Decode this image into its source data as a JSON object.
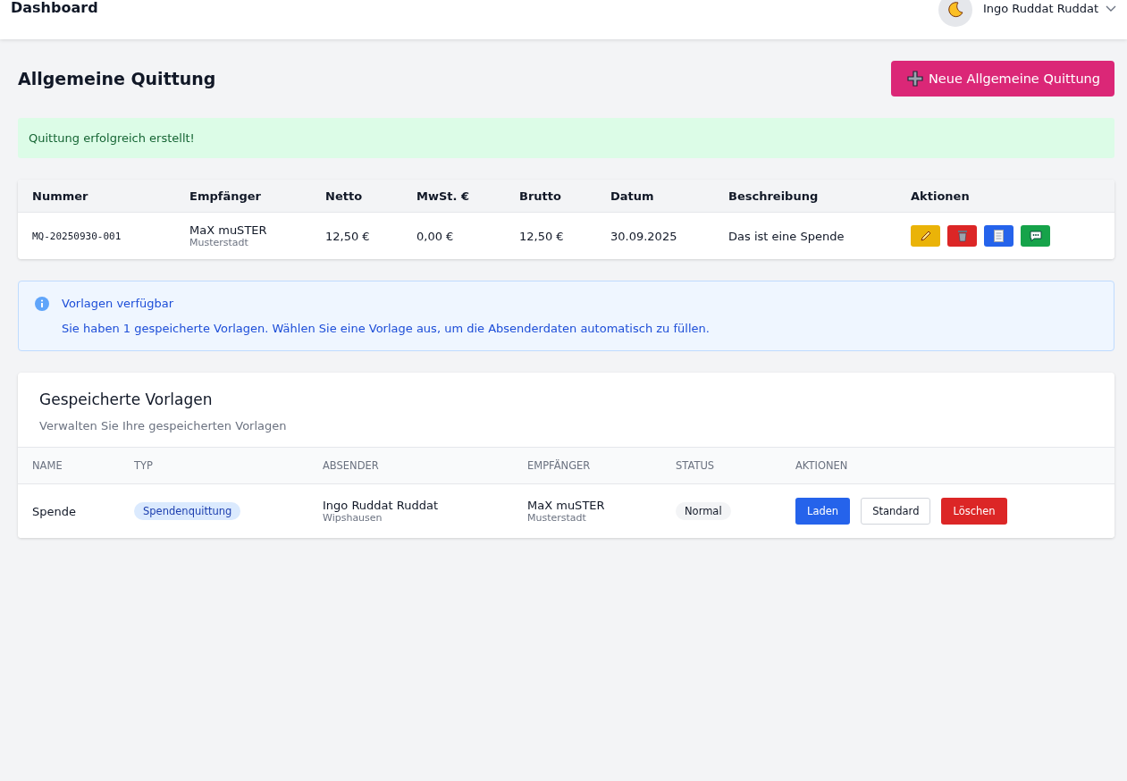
{
  "header": {
    "title": "Dashboard",
    "user": "Ingo Ruddat Ruddat"
  },
  "page": {
    "title": "Allgemeine Quittung",
    "new_button": "Neue Allgemeine Quittung"
  },
  "alert": "Quittung erfolgreich erstellt!",
  "receipts": {
    "columns": [
      "Nummer",
      "Empfänger",
      "Netto",
      "MwSt. €",
      "Brutto",
      "Datum",
      "Beschreibung",
      "Aktionen"
    ],
    "rows": [
      {
        "nummer": "MQ-20250930-001",
        "empfaenger": "MaX muSTER",
        "ort": "Musterstadt",
        "netto": "12,50 €",
        "mwst": "0,00 €",
        "brutto": "12,50 €",
        "datum": "30.09.2025",
        "beschreibung": "Das ist eine Spende",
        "actions": [
          {
            "kind": "edit"
          },
          {
            "kind": "delete"
          },
          {
            "kind": "document"
          },
          {
            "kind": "message"
          }
        ]
      }
    ]
  },
  "info": {
    "title": "Vorlagen verfügbar",
    "text": "Sie haben 1 gespeicherte Vorlagen. Wählen Sie eine Vorlage aus, um die Absenderdaten automatisch zu füllen."
  },
  "templates": {
    "title": "Gespeicherte Vorlagen",
    "subtitle": "Verwalten Sie Ihre gespeicherten Vorlagen",
    "columns": [
      "NAME",
      "TYP",
      "ABSENDER",
      "EMPFÄNGER",
      "STATUS",
      "AKTIONEN"
    ],
    "rows": [
      {
        "name": "Spende",
        "typ": "Spendenquittung",
        "absender": "Ingo Ruddat Ruddat",
        "absender_ort": "Wipshausen",
        "empfaenger": "MaX muSTER",
        "empfaenger_ort": "Musterstadt",
        "status": "Normal",
        "buttons": [
          {
            "kind": "primary",
            "label": "Laden"
          },
          {
            "kind": "outline",
            "label": "Standard"
          },
          {
            "kind": "danger",
            "label": "Löschen"
          }
        ]
      }
    ]
  }
}
